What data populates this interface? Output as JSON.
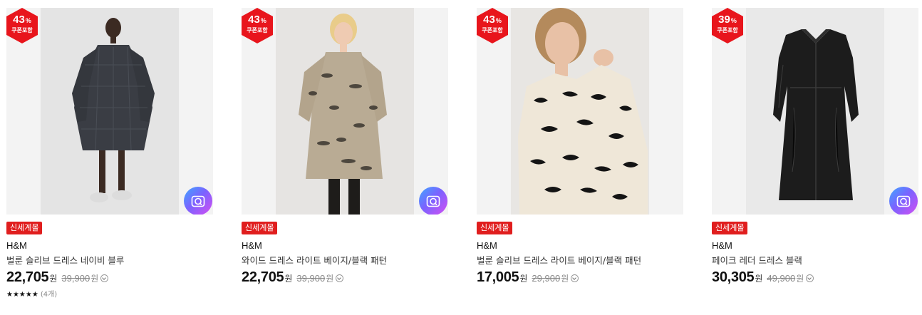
{
  "products": [
    {
      "discount": "43",
      "discount_unit": "%",
      "coupon_label": "쿠폰포함",
      "tag": "신세계몰",
      "brand": "H&M",
      "name": "벌룬 슬리브 드레스 네이비 블루",
      "price": "22,705",
      "price_unit": "원",
      "original_price": "39,900",
      "original_unit": "원",
      "rating_stars": "★★★★★",
      "rating_value": 4.5,
      "review_count": "(4개)",
      "image": "model-navy-check-dress"
    },
    {
      "discount": "43",
      "discount_unit": "%",
      "coupon_label": "쿠폰포함",
      "tag": "신세계몰",
      "brand": "H&M",
      "name": "와이드 드레스 라이트 베이지/블랙 패턴",
      "price": "22,705",
      "price_unit": "원",
      "original_price": "39,900",
      "original_unit": "원",
      "image": "model-beige-pattern-dress"
    },
    {
      "discount": "43",
      "discount_unit": "%",
      "coupon_label": "쿠폰포함",
      "tag": "신세계몰",
      "brand": "H&M",
      "name": "벌룬 슬리브 드레스 라이트 베이지/블랙 패턴",
      "price": "17,005",
      "price_unit": "원",
      "original_price": "29,900",
      "original_unit": "원",
      "image": "model-beige-black-pattern-closeup"
    },
    {
      "discount": "39",
      "discount_unit": "%",
      "coupon_label": "쿠폰포함",
      "tag": "신세계몰",
      "brand": "H&M",
      "name": "페이크 레더 드레스 블랙",
      "price": "30,305",
      "price_unit": "원",
      "original_price": "49,900",
      "original_unit": "원",
      "image": "black-faux-leather-dress"
    }
  ],
  "colors": {
    "badge": "#e8151c",
    "tag": "#e01e1e",
    "camera_gradient": [
      "#3fa7ff",
      "#7a63ff",
      "#d54ef2"
    ]
  },
  "icons": {
    "camera": "camera-search-icon",
    "info": "info-chevron-icon"
  }
}
